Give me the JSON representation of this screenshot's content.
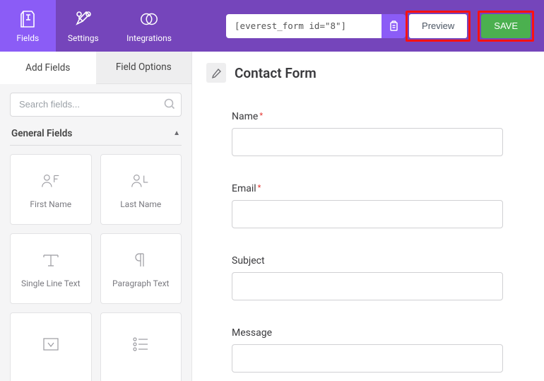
{
  "topbar": {
    "nav": [
      {
        "label": "Fields",
        "icon": "fields-icon",
        "active": true
      },
      {
        "label": "Settings",
        "icon": "settings-icon",
        "active": false
      },
      {
        "label": "Integrations",
        "icon": "integrations-icon",
        "active": false
      }
    ],
    "shortcode": "[everest_form id=\"8\"]",
    "preview_label": "Preview",
    "save_label": "SAVE"
  },
  "sidebar": {
    "tabs": {
      "add_fields": "Add Fields",
      "field_options": "Field Options"
    },
    "search_placeholder": "Search fields...",
    "section_title": "General Fields",
    "fields": [
      {
        "label": "First Name"
      },
      {
        "label": "Last Name"
      },
      {
        "label": "Single Line Text"
      },
      {
        "label": "Paragraph Text"
      },
      {
        "label": ""
      },
      {
        "label": ""
      }
    ]
  },
  "canvas": {
    "title": "Contact Form",
    "fields": [
      {
        "label": "Name",
        "required": true
      },
      {
        "label": "Email",
        "required": true
      },
      {
        "label": "Subject",
        "required": false
      },
      {
        "label": "Message",
        "required": false
      }
    ]
  },
  "colors": {
    "primary": "#7545bb",
    "primary_light": "#8b5cf6",
    "save_green": "#4bb04f",
    "highlight_red": "#ff1111"
  }
}
